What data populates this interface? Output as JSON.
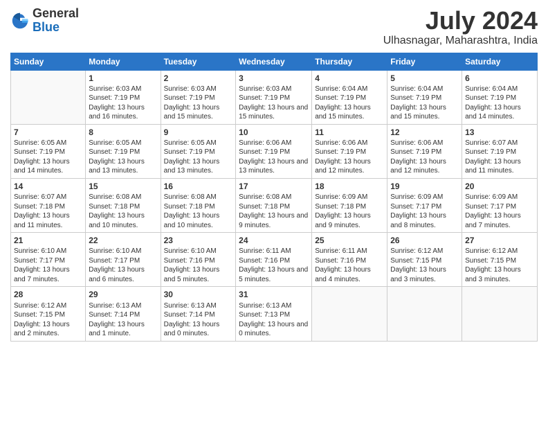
{
  "logo": {
    "general": "General",
    "blue": "Blue"
  },
  "title": "July 2024",
  "subtitle": "Ulhasnagar, Maharashtra, India",
  "days_header": [
    "Sunday",
    "Monday",
    "Tuesday",
    "Wednesday",
    "Thursday",
    "Friday",
    "Saturday"
  ],
  "weeks": [
    [
      {
        "day": "",
        "sunrise": "",
        "sunset": "",
        "daylight": ""
      },
      {
        "day": "1",
        "sunrise": "Sunrise: 6:03 AM",
        "sunset": "Sunset: 7:19 PM",
        "daylight": "Daylight: 13 hours and 16 minutes."
      },
      {
        "day": "2",
        "sunrise": "Sunrise: 6:03 AM",
        "sunset": "Sunset: 7:19 PM",
        "daylight": "Daylight: 13 hours and 15 minutes."
      },
      {
        "day": "3",
        "sunrise": "Sunrise: 6:03 AM",
        "sunset": "Sunset: 7:19 PM",
        "daylight": "Daylight: 13 hours and 15 minutes."
      },
      {
        "day": "4",
        "sunrise": "Sunrise: 6:04 AM",
        "sunset": "Sunset: 7:19 PM",
        "daylight": "Daylight: 13 hours and 15 minutes."
      },
      {
        "day": "5",
        "sunrise": "Sunrise: 6:04 AM",
        "sunset": "Sunset: 7:19 PM",
        "daylight": "Daylight: 13 hours and 15 minutes."
      },
      {
        "day": "6",
        "sunrise": "Sunrise: 6:04 AM",
        "sunset": "Sunset: 7:19 PM",
        "daylight": "Daylight: 13 hours and 14 minutes."
      }
    ],
    [
      {
        "day": "7",
        "sunrise": "Sunrise: 6:05 AM",
        "sunset": "Sunset: 7:19 PM",
        "daylight": "Daylight: 13 hours and 14 minutes."
      },
      {
        "day": "8",
        "sunrise": "Sunrise: 6:05 AM",
        "sunset": "Sunset: 7:19 PM",
        "daylight": "Daylight: 13 hours and 13 minutes."
      },
      {
        "day": "9",
        "sunrise": "Sunrise: 6:05 AM",
        "sunset": "Sunset: 7:19 PM",
        "daylight": "Daylight: 13 hours and 13 minutes."
      },
      {
        "day": "10",
        "sunrise": "Sunrise: 6:06 AM",
        "sunset": "Sunset: 7:19 PM",
        "daylight": "Daylight: 13 hours and 13 minutes."
      },
      {
        "day": "11",
        "sunrise": "Sunrise: 6:06 AM",
        "sunset": "Sunset: 7:19 PM",
        "daylight": "Daylight: 13 hours and 12 minutes."
      },
      {
        "day": "12",
        "sunrise": "Sunrise: 6:06 AM",
        "sunset": "Sunset: 7:19 PM",
        "daylight": "Daylight: 13 hours and 12 minutes."
      },
      {
        "day": "13",
        "sunrise": "Sunrise: 6:07 AM",
        "sunset": "Sunset: 7:19 PM",
        "daylight": "Daylight: 13 hours and 11 minutes."
      }
    ],
    [
      {
        "day": "14",
        "sunrise": "Sunrise: 6:07 AM",
        "sunset": "Sunset: 7:18 PM",
        "daylight": "Daylight: 13 hours and 11 minutes."
      },
      {
        "day": "15",
        "sunrise": "Sunrise: 6:08 AM",
        "sunset": "Sunset: 7:18 PM",
        "daylight": "Daylight: 13 hours and 10 minutes."
      },
      {
        "day": "16",
        "sunrise": "Sunrise: 6:08 AM",
        "sunset": "Sunset: 7:18 PM",
        "daylight": "Daylight: 13 hours and 10 minutes."
      },
      {
        "day": "17",
        "sunrise": "Sunrise: 6:08 AM",
        "sunset": "Sunset: 7:18 PM",
        "daylight": "Daylight: 13 hours and 9 minutes."
      },
      {
        "day": "18",
        "sunrise": "Sunrise: 6:09 AM",
        "sunset": "Sunset: 7:18 PM",
        "daylight": "Daylight: 13 hours and 9 minutes."
      },
      {
        "day": "19",
        "sunrise": "Sunrise: 6:09 AM",
        "sunset": "Sunset: 7:17 PM",
        "daylight": "Daylight: 13 hours and 8 minutes."
      },
      {
        "day": "20",
        "sunrise": "Sunrise: 6:09 AM",
        "sunset": "Sunset: 7:17 PM",
        "daylight": "Daylight: 13 hours and 7 minutes."
      }
    ],
    [
      {
        "day": "21",
        "sunrise": "Sunrise: 6:10 AM",
        "sunset": "Sunset: 7:17 PM",
        "daylight": "Daylight: 13 hours and 7 minutes."
      },
      {
        "day": "22",
        "sunrise": "Sunrise: 6:10 AM",
        "sunset": "Sunset: 7:17 PM",
        "daylight": "Daylight: 13 hours and 6 minutes."
      },
      {
        "day": "23",
        "sunrise": "Sunrise: 6:10 AM",
        "sunset": "Sunset: 7:16 PM",
        "daylight": "Daylight: 13 hours and 5 minutes."
      },
      {
        "day": "24",
        "sunrise": "Sunrise: 6:11 AM",
        "sunset": "Sunset: 7:16 PM",
        "daylight": "Daylight: 13 hours and 5 minutes."
      },
      {
        "day": "25",
        "sunrise": "Sunrise: 6:11 AM",
        "sunset": "Sunset: 7:16 PM",
        "daylight": "Daylight: 13 hours and 4 minutes."
      },
      {
        "day": "26",
        "sunrise": "Sunrise: 6:12 AM",
        "sunset": "Sunset: 7:15 PM",
        "daylight": "Daylight: 13 hours and 3 minutes."
      },
      {
        "day": "27",
        "sunrise": "Sunrise: 6:12 AM",
        "sunset": "Sunset: 7:15 PM",
        "daylight": "Daylight: 13 hours and 3 minutes."
      }
    ],
    [
      {
        "day": "28",
        "sunrise": "Sunrise: 6:12 AM",
        "sunset": "Sunset: 7:15 PM",
        "daylight": "Daylight: 13 hours and 2 minutes."
      },
      {
        "day": "29",
        "sunrise": "Sunrise: 6:13 AM",
        "sunset": "Sunset: 7:14 PM",
        "daylight": "Daylight: 13 hours and 1 minute."
      },
      {
        "day": "30",
        "sunrise": "Sunrise: 6:13 AM",
        "sunset": "Sunset: 7:14 PM",
        "daylight": "Daylight: 13 hours and 0 minutes."
      },
      {
        "day": "31",
        "sunrise": "Sunrise: 6:13 AM",
        "sunset": "Sunset: 7:13 PM",
        "daylight": "Daylight: 13 hours and 0 minutes."
      },
      {
        "day": "",
        "sunrise": "",
        "sunset": "",
        "daylight": ""
      },
      {
        "day": "",
        "sunrise": "",
        "sunset": "",
        "daylight": ""
      },
      {
        "day": "",
        "sunrise": "",
        "sunset": "",
        "daylight": ""
      }
    ]
  ]
}
